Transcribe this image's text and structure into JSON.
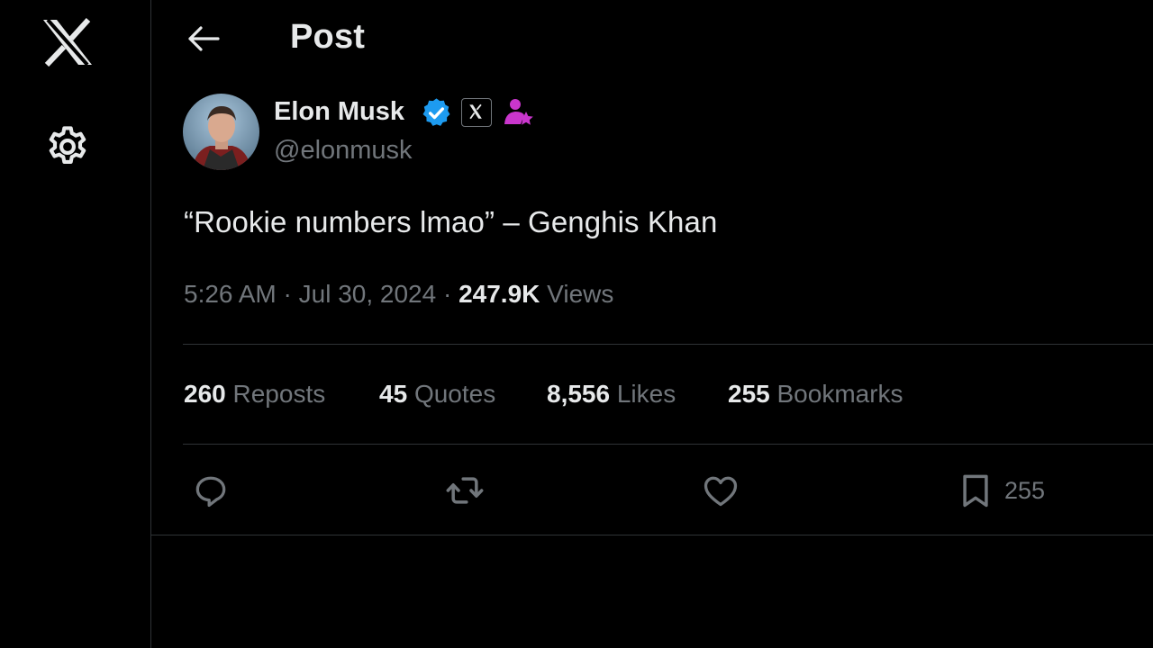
{
  "header": {
    "title": "Post"
  },
  "author": {
    "name": "Elon Musk",
    "handle": "@elonmusk"
  },
  "post": {
    "text": "“Rookie numbers lmao” – Genghis Khan",
    "time": "5:26 AM",
    "date": "Jul 30, 2024",
    "views_count": "247.9K",
    "views_label": "Views",
    "separator": "·"
  },
  "stats": [
    {
      "count": "260",
      "label": "Reposts"
    },
    {
      "count": "45",
      "label": "Quotes"
    },
    {
      "count": "8,556",
      "label": "Likes"
    },
    {
      "count": "255",
      "label": "Bookmarks"
    }
  ],
  "actions": {
    "bookmark_count": "255"
  },
  "icons": {
    "logo": "x-logo-icon",
    "settings": "gear-icon",
    "back": "arrow-left-icon",
    "verified": "verified-badge-icon",
    "affiliate": "x-affiliate-badge-icon",
    "subscriber": "subscriber-star-icon",
    "reply": "reply-icon",
    "repost": "repost-icon",
    "like": "heart-icon",
    "bookmark": "bookmark-icon"
  },
  "colors": {
    "background": "#000000",
    "text_primary": "#e7e9ea",
    "text_secondary": "#71767b",
    "border": "#2f3336",
    "verified": "#1d9bf0",
    "subscriber": "#c936cc"
  }
}
